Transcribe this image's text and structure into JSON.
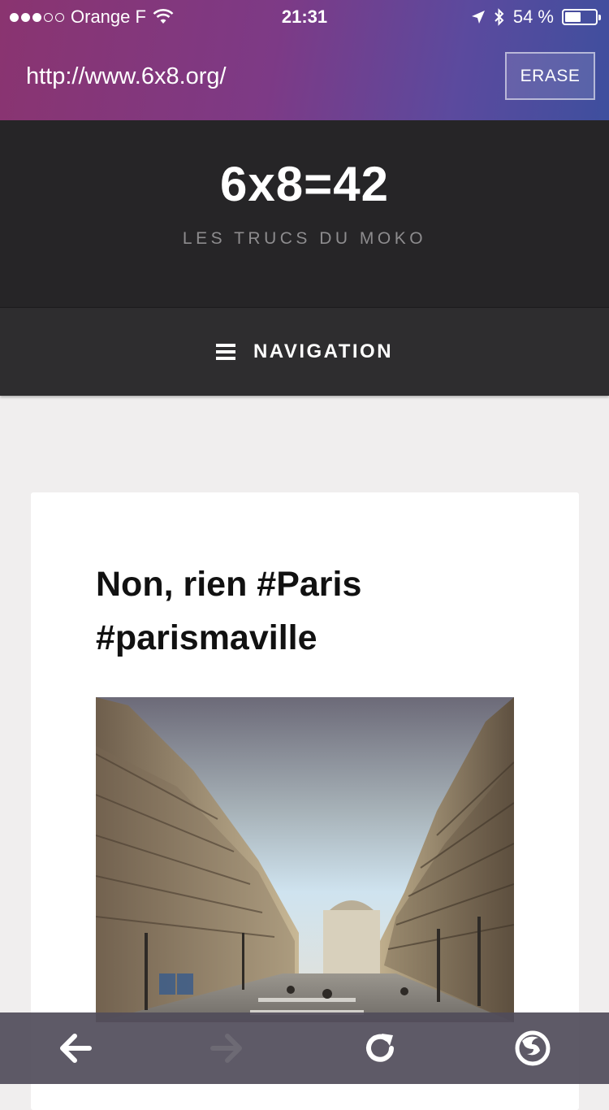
{
  "status_bar": {
    "carrier": "Orange F",
    "time": "21:31",
    "battery_text": "54 %",
    "battery_level": 0.54,
    "signal_bars_filled": 3,
    "signal_bars_total": 5
  },
  "browser": {
    "url": "http://www.6x8.org/",
    "erase_label": "ERASE"
  },
  "site": {
    "title": "6x8=42",
    "tagline": "LES TRUCS DU MOKO",
    "nav_label": "NAVIGATION"
  },
  "post": {
    "title": "Non, rien #Paris #parismaville",
    "image": "paris-street-photo"
  },
  "toolbar": {
    "back_icon": "arrow-left-icon",
    "forward_icon": "arrow-right-icon",
    "reload_icon": "reload-icon",
    "firefox_icon": "firefox-icon"
  },
  "colors": {
    "header_bg": "#262527",
    "nav_bg": "#2e2d2f",
    "page_bg": "#f0eeee",
    "chrome_gradient_start": "#8a3470",
    "chrome_gradient_end": "#3e4f9e"
  }
}
